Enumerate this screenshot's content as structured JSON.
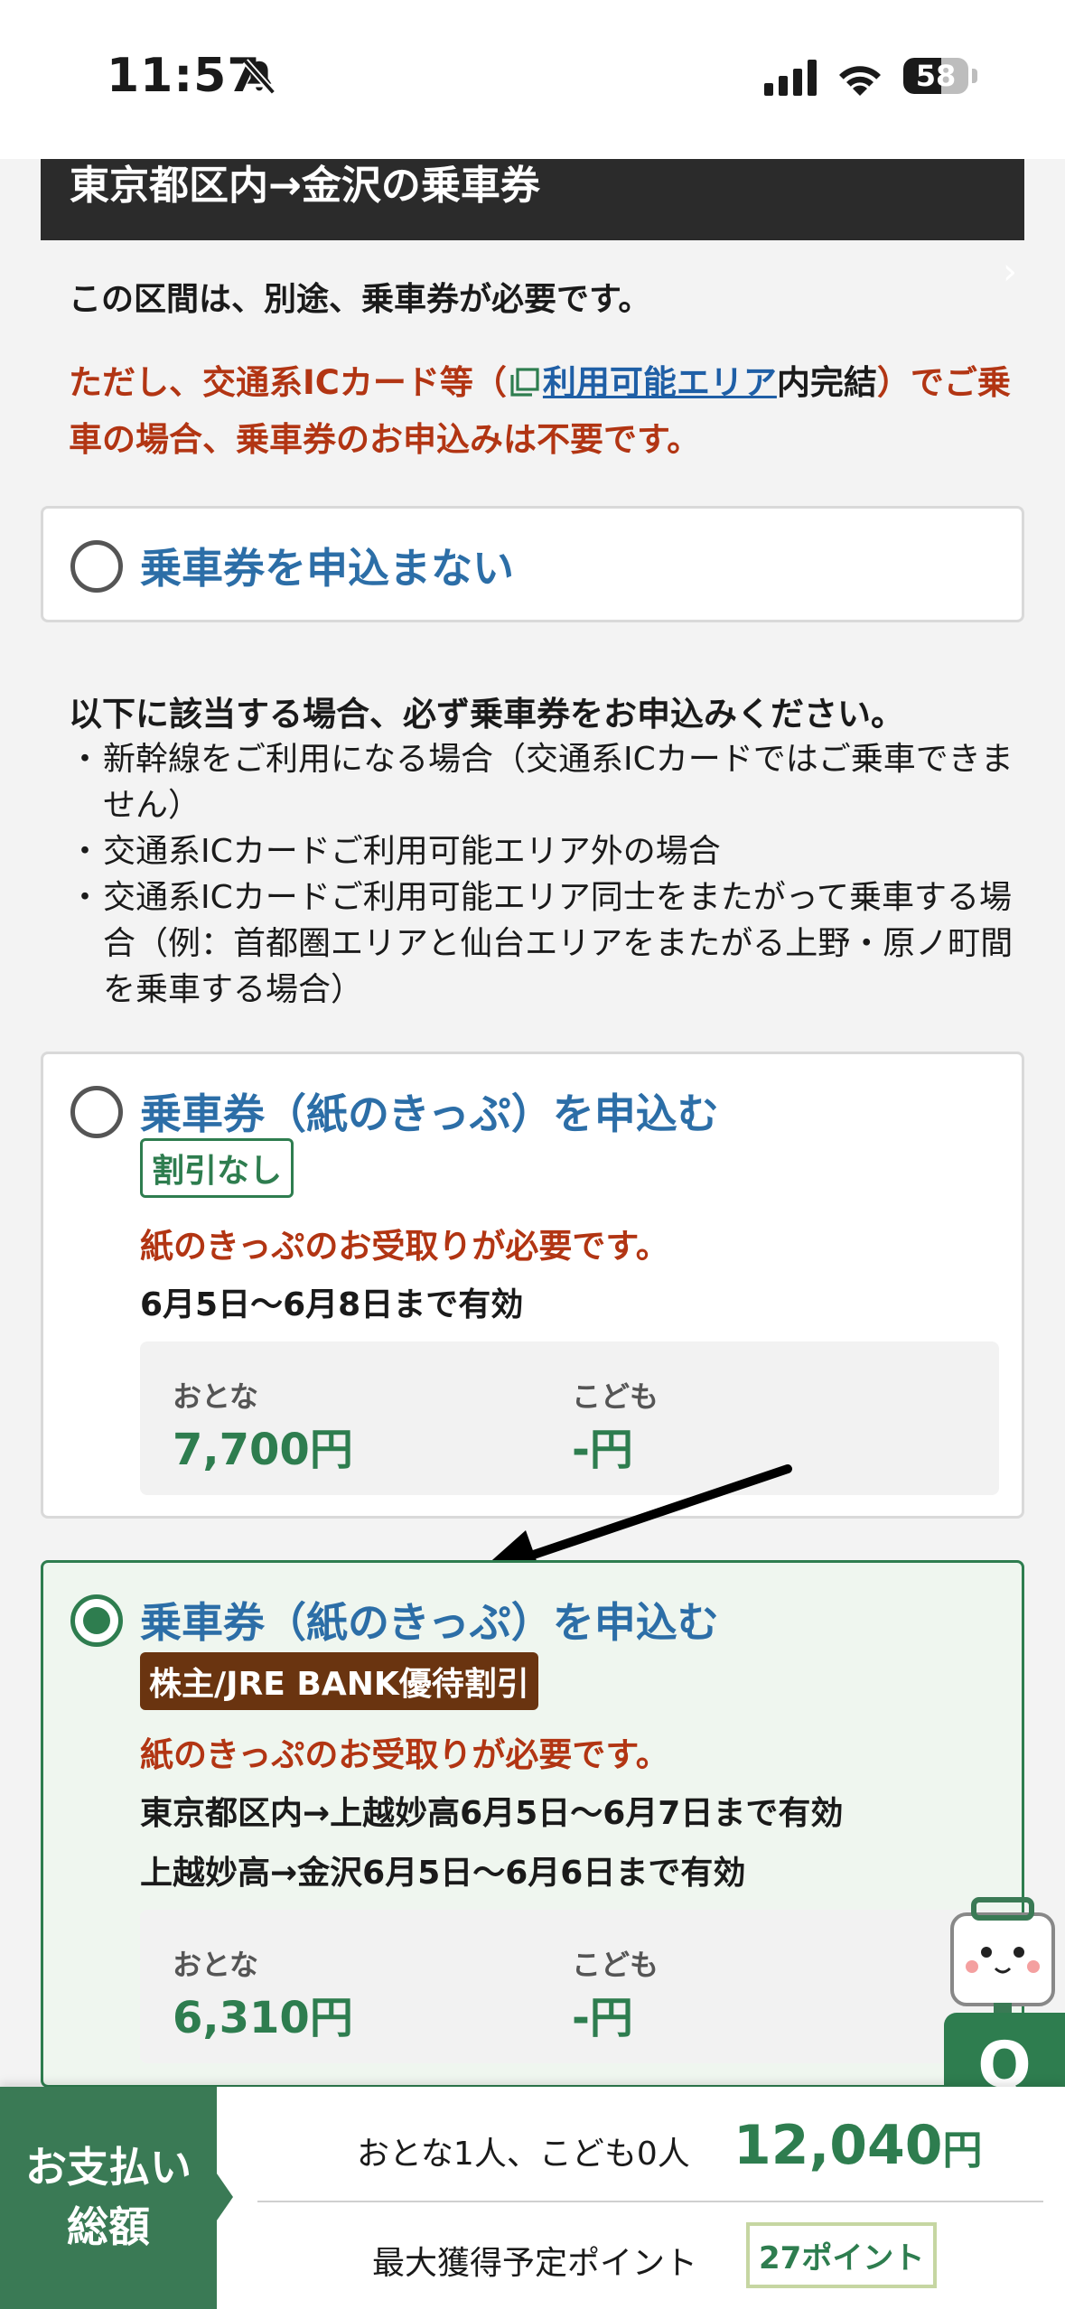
{
  "status_bar": {
    "time": "11:57",
    "battery": "58",
    "battery_level": 0.58
  },
  "header": {
    "title": "東京都区内→金沢の乗車券"
  },
  "notice": {
    "required": "この区間は、別途、乗車券が必要です。",
    "warn_pre": "ただし、交通系ICカード等（",
    "warn_link": "利用可能エリア",
    "warn_inner": "内完結",
    "warn_post": "）でご乗車の場合、乗車券のお申込みは不要です。"
  },
  "option_none": {
    "label": "乗車券を申込まない"
  },
  "info": {
    "title": "以下に該当する場合、必ず乗車券をお申込みください。",
    "bullets": [
      "新幹線をご利用になる場合（交通系ICカードではご乗車できません）",
      "交通系ICカードご利用可能エリア外の場合",
      "交通系ICカードご利用可能エリア同士をまたがって乗車する場合（例：首都圏エリアと仙台エリアをまたがる上野・原ノ町間を乗車する場合）"
    ]
  },
  "option_paper": {
    "label": "乗車券（紙のきっぷ）を申込む",
    "badge": "割引なし",
    "note": "紙のきっぷのお受取りが必要です。",
    "validity": "6月5日〜6月8日まで有効",
    "adult_label": "おとな",
    "adult_price": "7,700円",
    "child_label": "こども",
    "child_price": "-円"
  },
  "option_discount": {
    "label": "乗車券（紙のきっぷ）を申込む",
    "badge": "株主/JRE BANK優待割引",
    "note": "紙のきっぷのお受取りが必要です。",
    "validity_1": "東京都区内→上越妙高6月5日〜6月7日まで有効",
    "validity_2": "上越妙高→金沢6月5日〜6月6日まで有効",
    "adult_label": "おとな",
    "adult_price": "6,310円",
    "child_label": "こども",
    "child_price": "-円"
  },
  "floating": {
    "q_label": "Q"
  },
  "footer": {
    "pay_line1": "お支払い",
    "pay_line2": "総額",
    "people": "おとな1人、こども0人",
    "total_amount": "12,040",
    "total_unit": "円",
    "points_label": "最大獲得予定ポイント",
    "points_badge": "27ポイント"
  },
  "colors": {
    "accent_green": "#2e7d4f",
    "warning_red": "#b23513",
    "link_blue": "#2c6ea7",
    "badge_brown": "#6a3410"
  }
}
